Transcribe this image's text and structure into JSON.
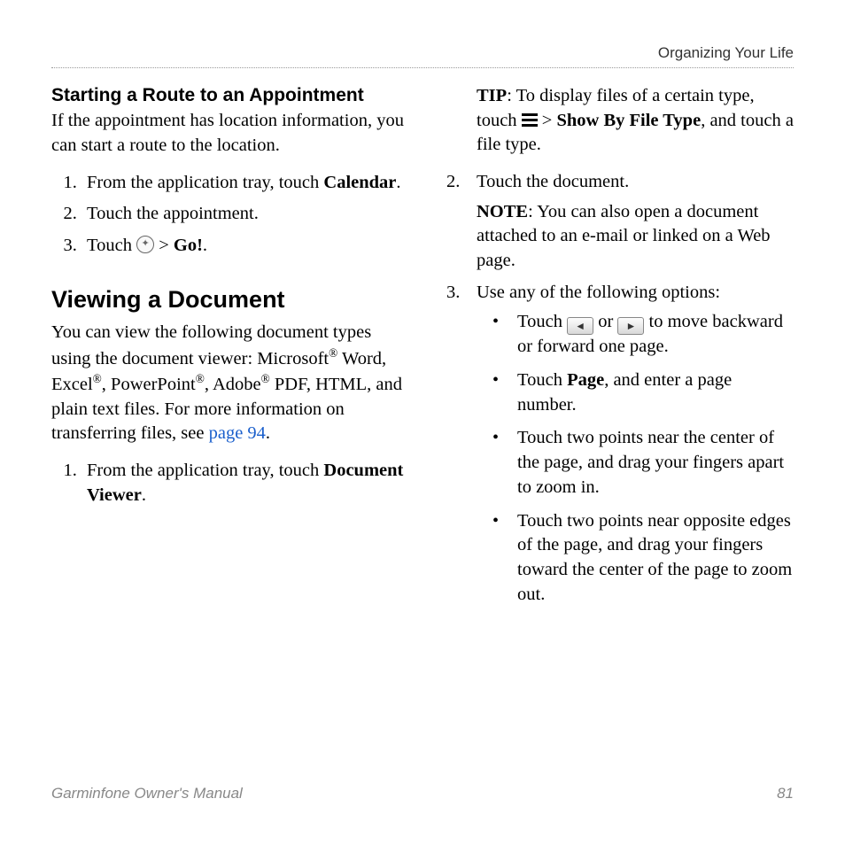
{
  "header": {
    "chapter": "Organizing Your Life"
  },
  "left": {
    "heading1": "Starting a Route to an Appointment",
    "intro1": "If the appointment has location information, you can start a route to the location.",
    "step1a_pre": "From the application tray, touch ",
    "step1a_bold": "Calendar",
    "step1a_post": ".",
    "step1b": "Touch the appointment.",
    "step1c_pre": "Touch ",
    "step1c_mid": " > ",
    "step1c_bold": "Go!",
    "step1c_post": ".",
    "heading2": "Viewing a Document",
    "intro2_pre": "You can view the following document types using the document viewer: Microsoft",
    "reg": "®",
    "intro2_word": " Word, Excel",
    "intro2_pp": ", PowerPoint",
    "intro2_adobe": ", Adobe",
    "intro2_rest": " PDF, HTML, and plain text files. For more information on transferring files, see ",
    "intro2_link": "page 94",
    "intro2_end": ".",
    "step2a_pre": "From the application tray, touch ",
    "step2a_bold": "Document Viewer",
    "step2a_post": "."
  },
  "right": {
    "tip_label": "TIP",
    "tip_pre": ": To display files of a certain type, touch ",
    "tip_mid": " > ",
    "tip_bold": "Show By File Type",
    "tip_post": ", and touch a file type.",
    "step2": "Touch the document.",
    "note_label": "NOTE",
    "note_text": ": You can also open a document attached to an e-mail or linked on a Web page.",
    "step3": "Use any of the following options:",
    "bullet1_pre": "Touch ",
    "bullet1_mid": " or ",
    "bullet1_post": " to move backward or forward one page.",
    "bullet2_pre": "Touch ",
    "bullet2_bold": "Page",
    "bullet2_post": ", and enter a page number.",
    "bullet3": "Touch two points near the center of the page, and drag your fingers apart to zoom in.",
    "bullet4": "Touch two points near opposite edges of the page, and drag your fingers toward the center of the page to zoom out."
  },
  "footer": {
    "book": "Garminfone Owner's Manual",
    "page": "81"
  }
}
